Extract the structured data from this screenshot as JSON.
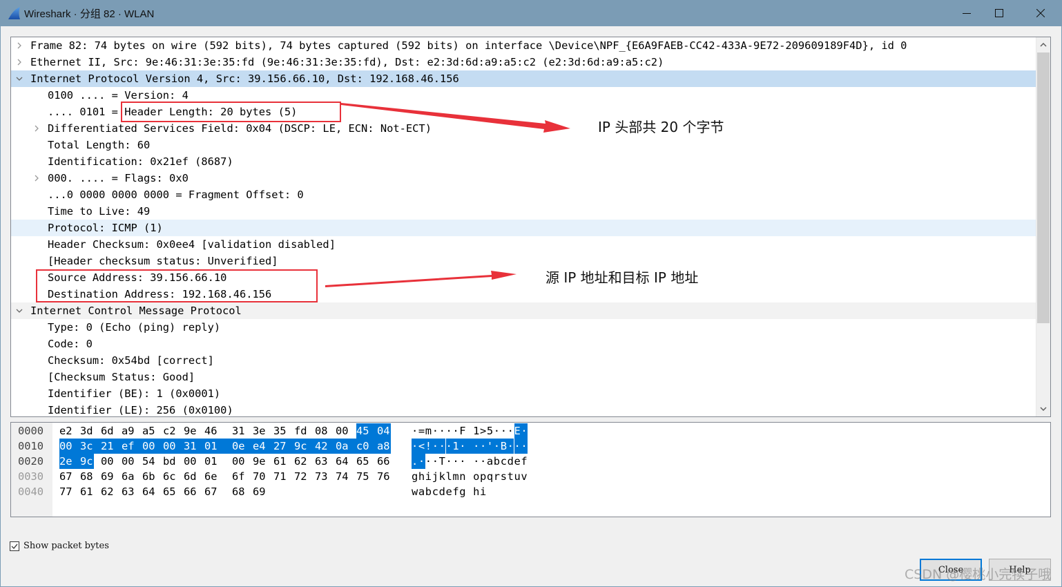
{
  "window": {
    "title": "Wireshark · 分组 82 · WLAN",
    "app_icon": "wireshark-fin-icon",
    "controls": {
      "minimize": "minimize-icon",
      "maximize": "maximize-icon",
      "close": "close-icon"
    }
  },
  "tree": {
    "rows": [
      {
        "level": 0,
        "expander": "collapsed",
        "state": "",
        "text": "Frame 82: 74 bytes on wire (592 bits), 74 bytes captured (592 bits) on interface \\Device\\NPF_{E6A9FAEB-CC42-433A-9E72-209609189F4D}, id 0"
      },
      {
        "level": 0,
        "expander": "collapsed",
        "state": "",
        "text": "Ethernet II, Src: 9e:46:31:3e:35:fd (9e:46:31:3e:35:fd), Dst: e2:3d:6d:a9:a5:c2 (e2:3d:6d:a9:a5:c2)"
      },
      {
        "level": 0,
        "expander": "expanded",
        "state": "selected",
        "text": "Internet Protocol Version 4, Src: 39.156.66.10, Dst: 192.168.46.156"
      },
      {
        "level": 1,
        "expander": "none",
        "state": "",
        "text": "0100 .... = Version: 4"
      },
      {
        "level": 1,
        "expander": "none",
        "state": "",
        "text": ".... 0101 = Header Length: 20 bytes (5)"
      },
      {
        "level": 1,
        "expander": "collapsed",
        "state": "",
        "text": "Differentiated Services Field: 0x04 (DSCP: LE, ECN: Not-ECT)"
      },
      {
        "level": 1,
        "expander": "none",
        "state": "",
        "text": "Total Length: 60"
      },
      {
        "level": 1,
        "expander": "none",
        "state": "",
        "text": "Identification: 0x21ef (8687)"
      },
      {
        "level": 1,
        "expander": "collapsed",
        "state": "",
        "text": "000. .... = Flags: 0x0"
      },
      {
        "level": 1,
        "expander": "none",
        "state": "",
        "text": "...0 0000 0000 0000 = Fragment Offset: 0"
      },
      {
        "level": 1,
        "expander": "none",
        "state": "",
        "text": "Time to Live: 49"
      },
      {
        "level": 1,
        "expander": "none",
        "state": "hover",
        "text": "Protocol: ICMP (1)"
      },
      {
        "level": 1,
        "expander": "none",
        "state": "",
        "text": "Header Checksum: 0x0ee4 [validation disabled]"
      },
      {
        "level": 1,
        "expander": "none",
        "state": "",
        "text": "[Header checksum status: Unverified]"
      },
      {
        "level": 1,
        "expander": "none",
        "state": "",
        "text": "Source Address: 39.156.66.10"
      },
      {
        "level": 1,
        "expander": "none",
        "state": "",
        "text": "Destination Address: 192.168.46.156"
      },
      {
        "level": 0,
        "expander": "expanded",
        "state": "alt",
        "text": "Internet Control Message Protocol"
      },
      {
        "level": 1,
        "expander": "none",
        "state": "",
        "text": "Type: 0 (Echo (ping) reply)"
      },
      {
        "level": 1,
        "expander": "none",
        "state": "",
        "text": "Code: 0"
      },
      {
        "level": 1,
        "expander": "none",
        "state": "",
        "text": "Checksum: 0x54bd [correct]"
      },
      {
        "level": 1,
        "expander": "none",
        "state": "",
        "text": "[Checksum Status: Good]"
      },
      {
        "level": 1,
        "expander": "none",
        "state": "",
        "text": "Identifier (BE): 1 (0x0001)"
      },
      {
        "level": 1,
        "expander": "none",
        "state": "",
        "text": "Identifier (LE): 256 (0x0100)"
      }
    ]
  },
  "annotations": [
    {
      "text": "IP 头部共 20 个字节",
      "color": "#e8313a"
    },
    {
      "text": "源 IP 地址和目标 IP 地址",
      "color": "#e8313a"
    }
  ],
  "bytes": {
    "selection_color": "#0078d7",
    "rows": [
      {
        "offset": "0000",
        "hex": [
          "e2",
          "3d",
          "6d",
          "a9",
          "a5",
          "c2",
          "9e",
          "46",
          "31",
          "3e",
          "35",
          "fd",
          "08",
          "00",
          "45",
          "04"
        ],
        "ascii": [
          "·",
          "=",
          "m",
          "·",
          "·",
          "·",
          "·",
          "F",
          "1",
          ">",
          "5",
          "·",
          "·",
          "·",
          "E",
          "·"
        ],
        "sel_from": 14,
        "sel_to": 15
      },
      {
        "offset": "0010",
        "hex": [
          "00",
          "3c",
          "21",
          "ef",
          "00",
          "00",
          "31",
          "01",
          "0e",
          "e4",
          "27",
          "9c",
          "42",
          "0a",
          "c0",
          "a8"
        ],
        "ascii": [
          "·",
          "<",
          "!",
          "·",
          "·",
          "·",
          "1",
          "·",
          "·",
          "·",
          "'",
          "·",
          "B",
          "·",
          "·",
          "·"
        ],
        "sel_from": 0,
        "sel_to": 15
      },
      {
        "offset": "0020",
        "hex": [
          "2e",
          "9c",
          "00",
          "00",
          "54",
          "bd",
          "00",
          "01",
          "00",
          "9e",
          "61",
          "62",
          "63",
          "64",
          "65",
          "66"
        ],
        "ascii": [
          ".",
          "·",
          "·",
          "·",
          "T",
          "·",
          "·",
          "·",
          "·",
          "·",
          "a",
          "b",
          "c",
          "d",
          "e",
          "f"
        ],
        "sel_from": 0,
        "sel_to": 1
      },
      {
        "offset": "0030",
        "hex": [
          "67",
          "68",
          "69",
          "6a",
          "6b",
          "6c",
          "6d",
          "6e",
          "6f",
          "70",
          "71",
          "72",
          "73",
          "74",
          "75",
          "76"
        ],
        "ascii": [
          "g",
          "h",
          "i",
          "j",
          "k",
          "l",
          "m",
          "n",
          "o",
          "p",
          "q",
          "r",
          "s",
          "t",
          "u",
          "v"
        ],
        "sel_from": -1,
        "sel_to": -1
      },
      {
        "offset": "0040",
        "hex": [
          "77",
          "61",
          "62",
          "63",
          "64",
          "65",
          "66",
          "67",
          "68",
          "69"
        ],
        "ascii": [
          "w",
          "a",
          "b",
          "c",
          "d",
          "e",
          "f",
          "g",
          "h",
          "i"
        ],
        "sel_from": -1,
        "sel_to": -1
      }
    ]
  },
  "footer": {
    "show_packet_bytes_label": "Show packet bytes",
    "show_packet_bytes_checked": true,
    "close_label": "Close",
    "help_label": "Help"
  },
  "watermark": "CSDN @樱桃小完犊子哦"
}
